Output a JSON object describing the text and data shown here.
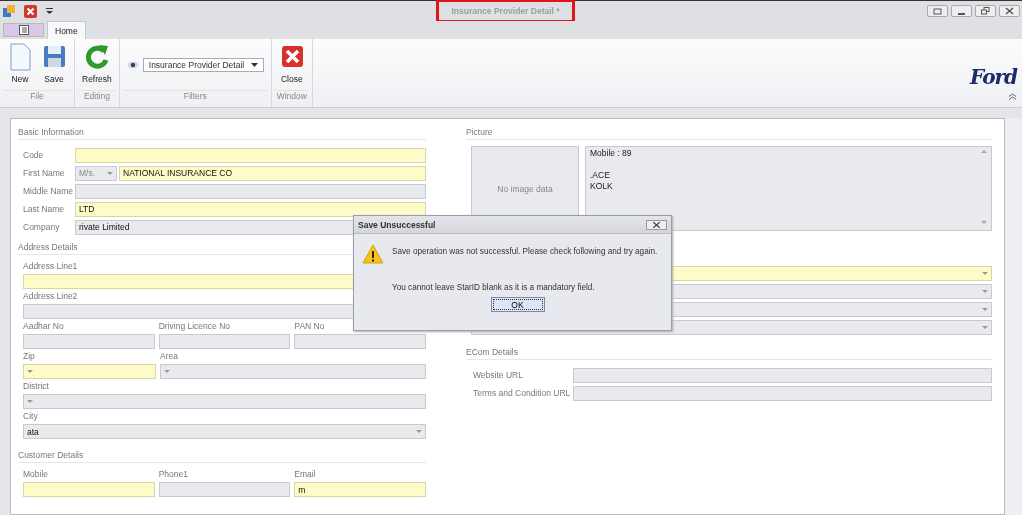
{
  "window": {
    "title": "Insurance Provider Detail *",
    "title_highlighted": true
  },
  "tabs": [
    {
      "label": "Home",
      "selected": true
    }
  ],
  "ribbon": {
    "groups": [
      {
        "label": "File",
        "kind": "buttons",
        "buttons": [
          {
            "label": "New"
          },
          {
            "label": "Save"
          }
        ]
      },
      {
        "label": "Editing",
        "kind": "buttons",
        "buttons": [
          {
            "label": "Refresh"
          }
        ]
      },
      {
        "label": "Filters",
        "kind": "filter",
        "value": "Insurance Provider Detail"
      },
      {
        "label": "Window",
        "kind": "buttons",
        "buttons": [
          {
            "label": "Close"
          }
        ]
      }
    ]
  },
  "logo": "Ford",
  "basic_information": {
    "title": "Basic Information",
    "fields": [
      {
        "label": "Code",
        "kind": "text",
        "required": true
      },
      {
        "label": "First Name",
        "kind": "name",
        "salutation": "M/s.",
        "value": "NATIONAL INSURANCE CO",
        "required": true
      },
      {
        "label": "Middle Name",
        "kind": "text",
        "required": false
      },
      {
        "label": "Last Name",
        "kind": "text",
        "value": "LTD",
        "required": true
      },
      {
        "label": "Company",
        "kind": "text",
        "value": "rivate Limited",
        "required": false
      }
    ]
  },
  "address_details": {
    "title": "Address Details",
    "rows": [
      [
        {
          "label": "Address Line1",
          "required": true,
          "dropdown": false
        }
      ],
      [
        {
          "label": "Address Line2",
          "required": false,
          "dropdown": false
        }
      ],
      [
        {
          "label": "Aadhar No",
          "required": false,
          "dropdown": false
        },
        {
          "label": "Driving Licence No",
          "required": false,
          "dropdown": false
        },
        {
          "label": "PAN No",
          "required": false,
          "dropdown": false
        }
      ],
      [
        {
          "label": "Zip",
          "required": true,
          "dropdown": true
        },
        {
          "label": "Area",
          "required": false,
          "dropdown": true
        }
      ],
      [
        {
          "label": "District",
          "required": false,
          "dropdown": true
        }
      ],
      [
        {
          "label": "City",
          "value": "ata",
          "required": false,
          "dropdown": true
        }
      ]
    ]
  },
  "customer_details": {
    "title": "Customer Details",
    "fields": [
      {
        "label": "Mobile",
        "required": true
      },
      {
        "label": "Phone1",
        "required": false
      },
      {
        "label": "Email",
        "value": "m",
        "required": true
      }
    ]
  },
  "picture": {
    "title": "Picture",
    "placeholder": "No image data",
    "address_lines": [
      "Mobile : 89",
      ".ACE",
      "KOLK"
    ]
  },
  "right_dropdowns": [
    {
      "required": true
    },
    {
      "required": false
    },
    {
      "required": false
    },
    {
      "required": false
    }
  ],
  "ecom_details": {
    "title": "ECom Details",
    "fields": [
      {
        "label": "Website URL"
      },
      {
        "label": "Terms and Condition URL"
      }
    ]
  },
  "dialog": {
    "title": "Save Unsuccessful",
    "messages": [
      "Save operation was not successful. Please check following and try again.",
      "You cannot leave StarID blank as it is a mandatory field."
    ],
    "button": "OK"
  }
}
